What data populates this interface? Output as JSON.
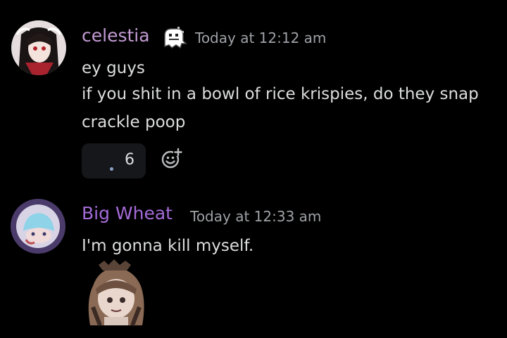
{
  "messages": [
    {
      "username": "celestia",
      "username_color": "#c39bd3",
      "timestamp": "Today at 12:12 am",
      "lines": [
        "ey guys",
        "if you shit in a bowl of rice krispies, do they snap",
        "crackle poop"
      ],
      "reaction": {
        "count": "6",
        "icon": "emoji-reaction"
      },
      "add_reaction_icon": "add-reaction-icon",
      "badge_icon": "pixel-ghost-badge-icon"
    },
    {
      "username": "Big Wheat",
      "username_color": "#a56bd8",
      "timestamp": "Today at 12:33 am",
      "lines": [
        "I'm gonna kill myself."
      ],
      "sticker_icon": "anime-girl-sticker"
    }
  ]
}
